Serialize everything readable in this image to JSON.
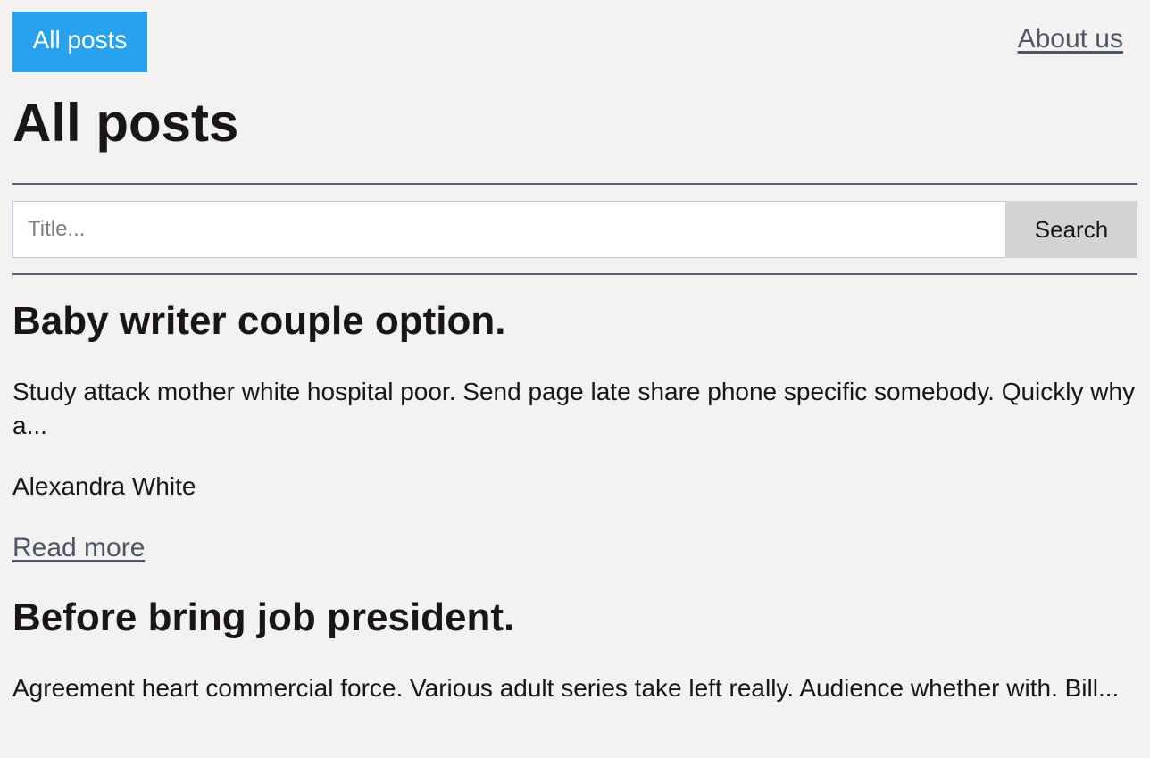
{
  "nav": {
    "all_posts_label": "All posts",
    "about_label": "About us"
  },
  "page": {
    "title": "All posts"
  },
  "search": {
    "placeholder": "Title...",
    "value": "",
    "button_label": "Search"
  },
  "posts": [
    {
      "title": "Baby writer couple option.",
      "excerpt": "Study attack mother white hospital poor. Send page late share phone specific somebody. Quickly why a...",
      "author": "Alexandra White",
      "read_more_label": "Read more"
    },
    {
      "title": "Before bring job president.",
      "excerpt": "Agreement heart commercial force. Various adult series take left really. Audience whether with. Bill...",
      "author": "",
      "read_more_label": ""
    }
  ],
  "colors": {
    "background": "#f4f2f0",
    "accent": "#29a2ee",
    "link": "#4d5567",
    "divider": "#5f5e70",
    "button_bg": "#d3d3d3"
  }
}
